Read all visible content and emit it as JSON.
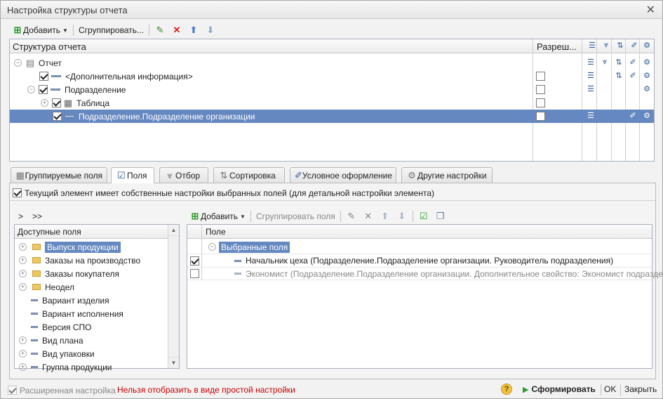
{
  "window": {
    "title": "Настройка структуры отчета"
  },
  "toolbar": {
    "add": "Добавить",
    "group": "Сгруппировать..."
  },
  "structure": {
    "header": "Структура отчета",
    "col_allow": "Разреш...",
    "rows": [
      {
        "label": "Отчет",
        "level": 0,
        "expander": "⊖",
        "checkbox": false,
        "icon": "report-icon"
      },
      {
        "label": "<Дополнительная информация>",
        "level": 2,
        "expander": "",
        "checkbox": true,
        "icon": "group-icon"
      },
      {
        "label": "Подразделение",
        "level": 1,
        "expander": "⊖",
        "checkbox": true,
        "icon": "group-icon"
      },
      {
        "label": "Таблица",
        "level": 2,
        "expander": "⊕",
        "checkbox": true,
        "icon": "table-icon"
      },
      {
        "label": "Подразделение.Подразделение организации",
        "level": 3,
        "expander": "",
        "checkbox": true,
        "icon": "group-icon",
        "selected": true
      }
    ]
  },
  "tabs": [
    "Группируемые поля",
    "Поля",
    "Отбор",
    "Сортировка",
    "Условное оформление",
    "Другие настройки"
  ],
  "active_tab": "Поля",
  "own_settings": "Текущий элемент имеет собственные настройки выбранных полей (для детальной настройки элемента)",
  "nav": {
    "one": ">",
    "all": ">>"
  },
  "available": {
    "header": "Доступные поля",
    "items": [
      {
        "label": "Выпуск продукции",
        "type": "folder",
        "selected": true
      },
      {
        "label": "Заказы на производство",
        "type": "folder"
      },
      {
        "label": "Заказы покупателя",
        "type": "folder"
      },
      {
        "label": "Неодел",
        "type": "folder"
      },
      {
        "label": "Вариант изделия",
        "type": "field"
      },
      {
        "label": "Вариант исполнения",
        "type": "field"
      },
      {
        "label": "Версия СПО",
        "type": "field"
      },
      {
        "label": "Вид плана",
        "type": "field"
      },
      {
        "label": "Вид упаковки",
        "type": "field"
      },
      {
        "label": "Группа продукции",
        "type": "field"
      }
    ]
  },
  "selected_toolbar": {
    "add": "Добавить",
    "group": "Сгруппировать поля"
  },
  "selected": {
    "header": "Поле",
    "group": "Выбранные поля",
    "items": [
      {
        "label": "Начальник цеха (Подразделение.Подразделение организации. Руководитель подразделения)",
        "checked": true,
        "dim": false
      },
      {
        "label": "Экономист (Подразделение.Подразделение организации. Дополнительное свойство: Экономист подразделе...",
        "checked": false,
        "dim": true
      }
    ]
  },
  "footer": {
    "extended": "Расширенная настройка",
    "warning": "Нельзя отобразить в виде простой настройки",
    "help": "?",
    "generate": "Сформировать",
    "ok": "OK",
    "close": "Закрыть"
  },
  "colors": {
    "selection": "#6688c0",
    "warning": "#cc0000",
    "green": "#2e9a2e"
  }
}
